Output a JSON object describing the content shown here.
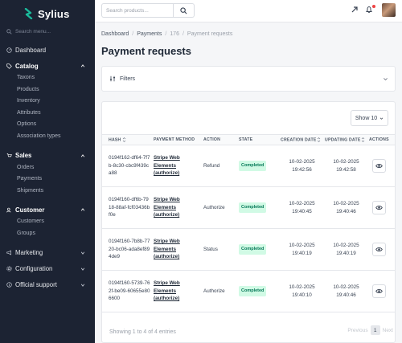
{
  "brand": {
    "name": "Sylius",
    "accent": "#1abb9c"
  },
  "sidebar": {
    "search_placeholder": "Search menu...",
    "dashboard": "Dashboard",
    "sections": [
      {
        "label": "Catalog",
        "icon": "tag-icon",
        "items": [
          "Taxons",
          "Products",
          "Inventory",
          "Attributes",
          "Options",
          "Association types"
        ]
      },
      {
        "label": "Sales",
        "icon": "cart-icon",
        "items": [
          "Orders",
          "Payments",
          "Shipments"
        ]
      },
      {
        "label": "Customer",
        "icon": "users-icon",
        "items": [
          "Customers",
          "Groups"
        ]
      },
      {
        "label": "Marketing",
        "icon": "megaphone-icon",
        "items": []
      },
      {
        "label": "Configuration",
        "icon": "gear-icon",
        "items": []
      },
      {
        "label": "Official support",
        "icon": "info-icon",
        "items": []
      }
    ]
  },
  "topbar": {
    "search_placeholder": "Search products..."
  },
  "breadcrumb": [
    "Dashboard",
    "Payments",
    "176",
    "Payment requests"
  ],
  "page": {
    "title": "Payment requests"
  },
  "filters": {
    "label": "Filters"
  },
  "table": {
    "show_label": "Show 10",
    "columns": [
      "HASH",
      "PAYMENT METHOD",
      "ACTION",
      "STATE",
      "CREATION DATE",
      "UPDATING DATE",
      "ACTIONS"
    ],
    "rows": [
      {
        "hash": "0194f162-df64-7f7b-8c30-cbc9f439ca88",
        "method": "Stripe Web Elements (authorize)",
        "action": "Refund",
        "state": "Completed",
        "created": "10-02-2025 19:42:56",
        "updated": "10-02-2025 19:42:58"
      },
      {
        "hash": "0194f160-df6b-7918-88af-fcf03436bf0e",
        "method": "Stripe Web Elements (authorize)",
        "action": "Authorize",
        "state": "Completed",
        "created": "10-02-2025 19:40:45",
        "updated": "10-02-2025 19:40:46"
      },
      {
        "hash": "0194f160-7b8b-7720-bc06-ada8ef894de9",
        "method": "Stripe Web Elements (authorize)",
        "action": "Status",
        "state": "Completed",
        "created": "10-02-2025 19:40:19",
        "updated": "10-02-2025 19:40:19"
      },
      {
        "hash": "0194f160-5739-762f-be09-60655e806600",
        "method": "Stripe Web Elements (authorize)",
        "action": "Authorize",
        "state": "Completed",
        "created": "10-02-2025 19:40:10",
        "updated": "10-02-2025 19:40:46"
      }
    ],
    "footer": "Showing 1 to 4 of 4 entries"
  },
  "pagination": {
    "previous": "Previous",
    "current": "1",
    "next": "Next"
  },
  "colors": {
    "sidebar_bg": "#1c2333",
    "badge_bg": "#d1fae5",
    "badge_text": "#047857"
  }
}
